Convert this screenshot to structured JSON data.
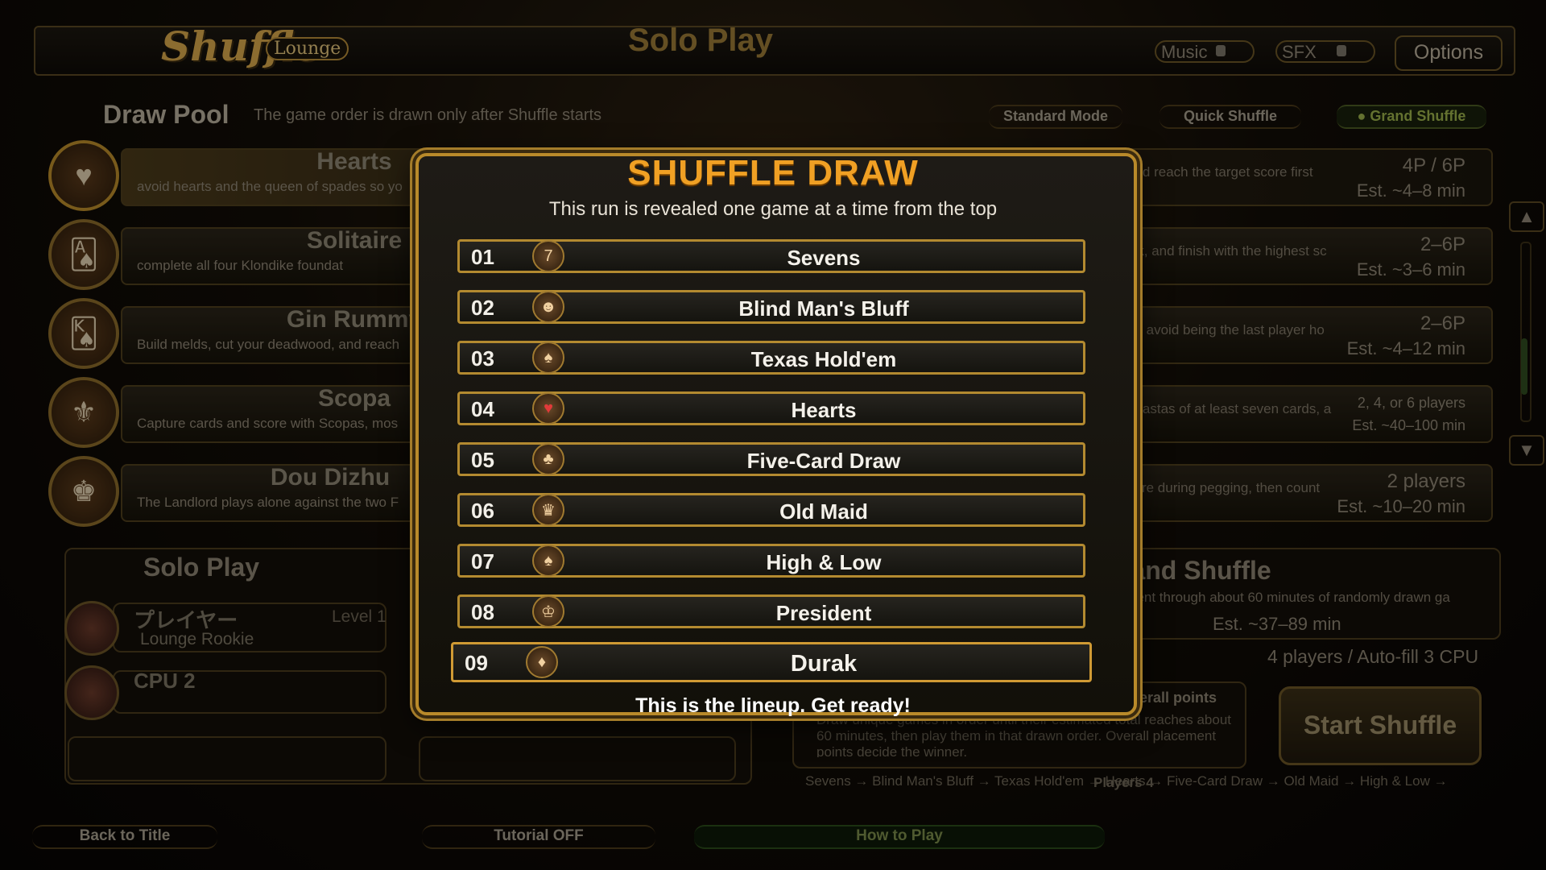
{
  "app": {
    "logo_text": "Shuffle",
    "logo_sub": "Lounge",
    "screen_title": "Solo Play"
  },
  "topbar": {
    "music_label": "Music",
    "sfx_label": "SFX",
    "options_label": "Options"
  },
  "draw_pool": {
    "title": "Draw Pool",
    "hint": "The game order is drawn only after Shuffle starts",
    "modes": [
      "Standard Mode",
      "Quick Shuffle",
      "● Grand Shuffle"
    ]
  },
  "games": [
    {
      "name": "Hearts",
      "desc": "avoid hearts and the queen of spades so yo",
      "right_desc": "and reach the target score first",
      "players": "4P / 6P",
      "est": "Est. ~4–8 min",
      "ghost": "Spades",
      "icon": "heart-icon"
    },
    {
      "name": "Solitaire",
      "desc": "complete all four Klondike foundat",
      "right_desc": "isk, and finish with the highest sc",
      "players": "2–6P",
      "est": "Est. ~3–6 min",
      "icon": "cards-icon"
    },
    {
      "name": "Gin Rummy",
      "desc": "Build melds, cut your deadwood, and reach",
      "right_desc": "nd avoid being the last player ho",
      "players": "2–6P",
      "est": "Est. ~4–12 min",
      "icon": "cards-icon"
    },
    {
      "name": "Scopa",
      "desc": "Capture cards and score with Scopas, mos",
      "right_desc": "anastas of at least seven cards, a",
      "players": "2, 4, or 6 players",
      "est": "Est. ~40–100 min",
      "icon": "coins-icon"
    },
    {
      "name": "Dou Dizhu",
      "desc": "The Landlord plays alone against the two F",
      "right_desc": "core during pegging, then count",
      "players": "2 players",
      "est": "Est. ~10–20 min",
      "icon": "crown-icon"
    }
  ],
  "solo": {
    "title": "Solo Play",
    "player_name": "プレイヤー",
    "player_title": "Lounge Rookie",
    "player_level": "Level 1",
    "cpu_name": "CPU 2"
  },
  "grand": {
    "title": "rand Shuffle",
    "desc": "nent through about 60 minutes of randomly drawn ga",
    "est": "Est. ~37–89 min",
    "players": "4 players / Auto-fill 3 CPU",
    "start_label": "Start Shuffle",
    "overall_title": "overall points",
    "overall_desc": "Draw unique games in order until their estimated total reaches about 60 minutes, then play them in that drawn order. Overall placement points decide the winner.",
    "lineup_strip": "Sevens → Blind Man's Bluff → Texas Hold'em → Hearts → Five-Card Draw → Old Maid → High & Low →",
    "players_strip": "Players 4"
  },
  "bottom": {
    "back_label": "Back to Title",
    "tutorial_label": "Tutorial OFF",
    "howto_label": "How to Play"
  },
  "modal": {
    "title": "SHUFFLE DRAW",
    "subtitle": "This run is revealed one game at a time from the top",
    "footer": "This is the lineup. Get ready!",
    "lineup": [
      {
        "num": "01",
        "name": "Sevens",
        "icon": "sevens-icon"
      },
      {
        "num": "02",
        "name": "Blind Man's Bluff",
        "icon": "bluff-icon"
      },
      {
        "num": "03",
        "name": "Texas Hold'em",
        "icon": "poker-icon"
      },
      {
        "num": "04",
        "name": "Hearts",
        "icon": "heart-icon"
      },
      {
        "num": "05",
        "name": "Five-Card Draw",
        "icon": "cards-icon"
      },
      {
        "num": "06",
        "name": "Old Maid",
        "icon": "maid-icon"
      },
      {
        "num": "07",
        "name": "High & Low",
        "icon": "spade-icon"
      },
      {
        "num": "08",
        "name": "President",
        "icon": "crown-icon"
      },
      {
        "num": "09",
        "name": "Durak",
        "icon": "durak-icon"
      }
    ]
  },
  "colors": {
    "accent_gold": "#b98a2a",
    "title_orange": "#f0a024",
    "active_green": "#9ab04a"
  }
}
